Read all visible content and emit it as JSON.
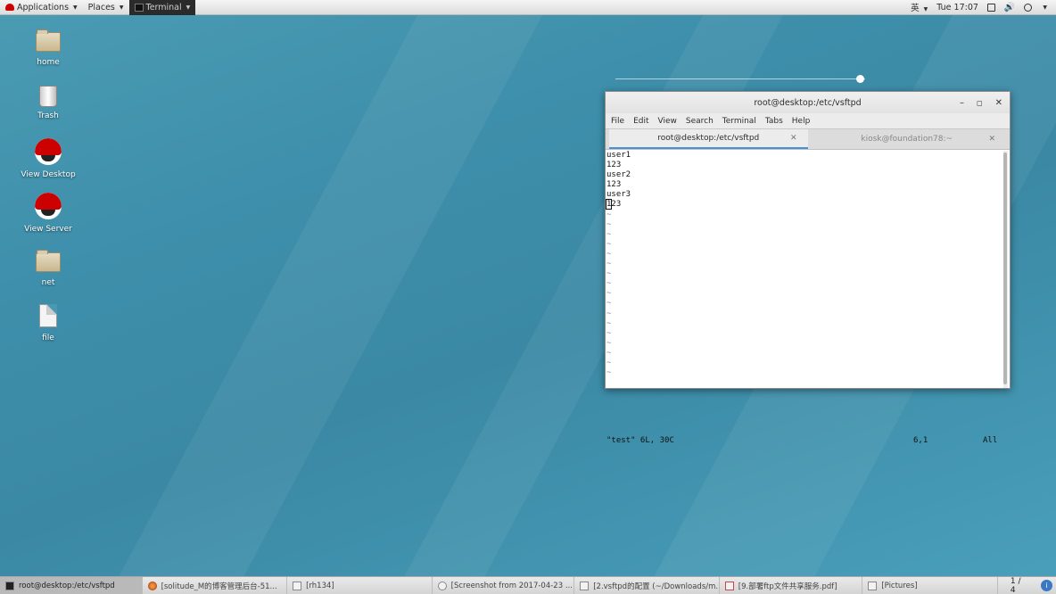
{
  "topbar": {
    "applications": "Applications",
    "places": "Places",
    "terminal": "Terminal",
    "input_method": "英",
    "clock": "Tue 17:07"
  },
  "desktop_icons": [
    {
      "label": "home",
      "icon": "home-folder-icon"
    },
    {
      "label": "Trash",
      "icon": "trash-icon"
    },
    {
      "label": "View Desktop",
      "icon": "redhat-icon"
    },
    {
      "label": "View Server",
      "icon": "redhat-icon"
    },
    {
      "label": "net",
      "icon": "folder-icon"
    },
    {
      "label": "file",
      "icon": "file-icon"
    }
  ],
  "window": {
    "title": "root@desktop:/etc/vsftpd",
    "menu": [
      "File",
      "Edit",
      "View",
      "Search",
      "Terminal",
      "Tabs",
      "Help"
    ],
    "tabs": [
      {
        "label": "root@desktop:/etc/vsftpd",
        "active": true
      },
      {
        "label": "kiosk@foundation78:~",
        "active": false
      }
    ],
    "lines": [
      "user1",
      "123",
      "user2",
      "123",
      "user3",
      "123"
    ],
    "cursor_char": "1",
    "cursor_rest": "23",
    "tilde": "~",
    "status_file": "\"test\" 6L, 30C",
    "status_pos": "6,1",
    "status_pct": "All"
  },
  "taskbar": {
    "tasks": [
      "root@desktop:/etc/vsftpd",
      "[solitude_M的博客管理后台-51...",
      "[rh134]",
      "[Screenshot from 2017-04-23 ...",
      "[2.vsftpd的配置 (~/Downloads/m...",
      "[9.部署ftp文件共享服务.pdf]",
      "[Pictures]"
    ],
    "workspace": "1 / 4"
  }
}
